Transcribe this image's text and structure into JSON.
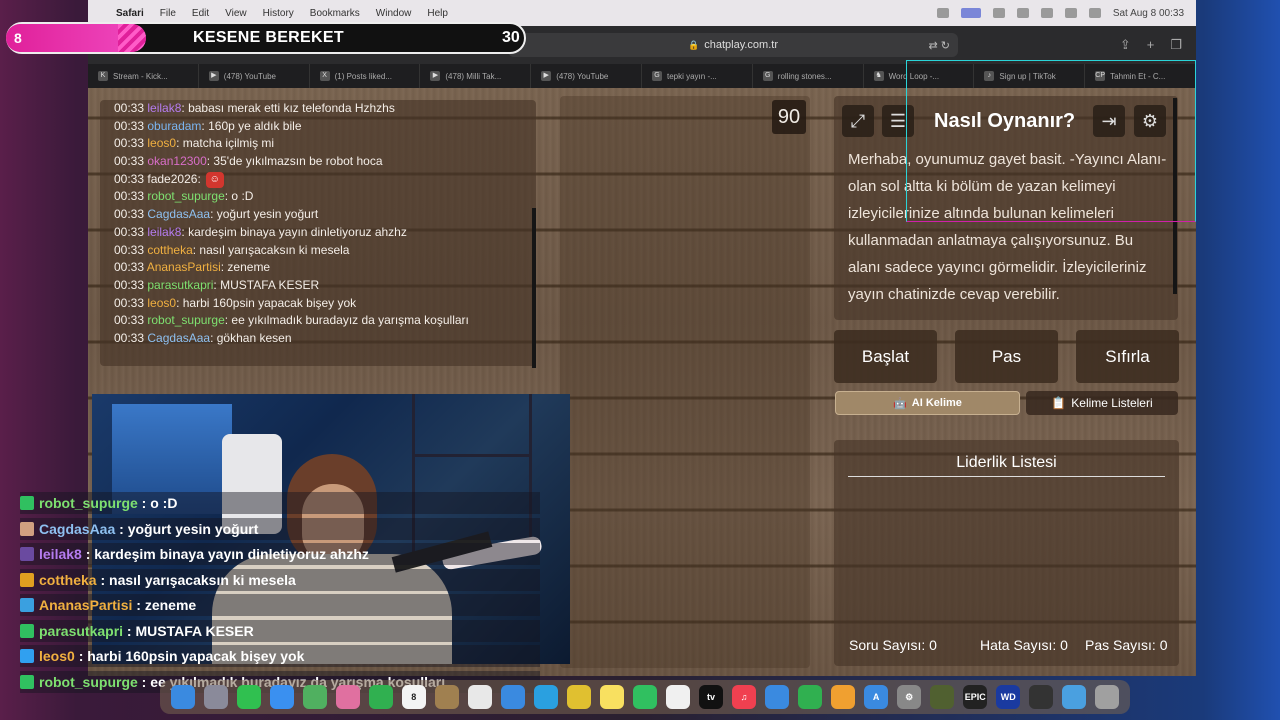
{
  "menubar": {
    "app": "Safari",
    "items": [
      "File",
      "Edit",
      "View",
      "History",
      "Bookmarks",
      "Window",
      "Help"
    ],
    "clock": "Sat Aug 8  00:33"
  },
  "browser": {
    "url": "chatplay.com.tr",
    "tabs": [
      {
        "label": "Stream - Kick...",
        "icon": "K"
      },
      {
        "label": "(478) YouTube",
        "icon": "▶"
      },
      {
        "label": "(1) Posts liked...",
        "icon": "X"
      },
      {
        "label": "(478) Milli Tak...",
        "icon": "▶"
      },
      {
        "label": "(478) YouTube",
        "icon": "▶"
      },
      {
        "label": "tepki yayın -...",
        "icon": "G"
      },
      {
        "label": "rolling stones...",
        "icon": "G"
      },
      {
        "label": "Word Loop -...",
        "icon": "♞"
      },
      {
        "label": "Sign up | TikTok",
        "icon": "♪"
      },
      {
        "label": "Tahmin Et - C...",
        "icon": "CP"
      }
    ]
  },
  "stream_overlay": {
    "score": "8",
    "title": "KESENE BEREKET",
    "count": "30"
  },
  "page_chat": [
    {
      "time": "00:33",
      "user": "leilak8",
      "color": "#b57cf0",
      "msg": ": babası merak etti kız telefonda Hzhzhs"
    },
    {
      "time": "00:33",
      "user": "oburadam",
      "color": "#7ab4f0",
      "msg": ": 160p ye aldık bile"
    },
    {
      "time": "00:33",
      "user": "leos0",
      "color": "#f0b040",
      "msg": ": matcha içilmiş mi"
    },
    {
      "time": "00:33",
      "user": "okan12300",
      "color": "#d86ec8",
      "msg": ": 35'de yıkılmazsın be robot hoca"
    },
    {
      "time": "00:33",
      "user": "fade2026",
      "color": "#f4eee8",
      "msg": ":",
      "badge": true
    },
    {
      "time": "00:33",
      "user": "robot_supurge",
      "color": "#7ee070",
      "msg": ": o :D"
    },
    {
      "time": "00:33",
      "user": "CagdasAaa",
      "color": "#8ec0f0",
      "msg": ": yoğurt yesin yoğurt"
    },
    {
      "time": "00:33",
      "user": "leilak8",
      "color": "#b57cf0",
      "msg": ": kardeşim binaya yayın dinletiyoruz ahzhz"
    },
    {
      "time": "00:33",
      "user": "cottheka",
      "color": "#f0b040",
      "msg": ": nasıl yarışacaksın ki mesela"
    },
    {
      "time": "00:33",
      "user": "AnanasPartisi",
      "color": "#f0b040",
      "msg": ": zeneme"
    },
    {
      "time": "00:33",
      "user": "parasutkapri",
      "color": "#7ee070",
      "msg": ": MUSTAFA KESER"
    },
    {
      "time": "00:33",
      "user": "leos0",
      "color": "#f0b040",
      "msg": ": harbi 160psin yapacak bişey yok"
    },
    {
      "time": "00:33",
      "user": "robot_supurge",
      "color": "#7ee070",
      "msg": ": ee yıkılmadık buradayız da yarışma koşulları"
    },
    {
      "time": "00:33",
      "user": "CagdasAaa",
      "color": "#8ec0f0",
      "msg": ": gökhan kesen"
    }
  ],
  "game": {
    "timer": "90",
    "howto_title": "Nasıl Oynanır?",
    "howto_text": "Merhaba, oyunumuz gayet basit. -Yayıncı Alanı- olan sol altta ki bölüm de yazan kelimeyi izleyicilerinize altında bulunan kelimeleri kullanmadan anlatmaya çalışıyorsunuz. Bu alanı sadece yayıncı görmelidir. İzleyicileriniz yayın chatinizde cevap verebilir.",
    "buttons": {
      "start": "Başlat",
      "pass": "Pas",
      "reset": "Sıfırla"
    },
    "ai_word": "AI Kelime",
    "word_lists": "Kelime Listeleri",
    "leaderboard_title": "Liderlik Listesi",
    "stats": {
      "questions": "Soru Sayısı: 0",
      "errors": "Hata Sayısı: 0",
      "passes": "Pas Sayısı: 0"
    }
  },
  "overlay_chat": [
    {
      "user": "robot_supurge",
      "color": "#7ee070",
      "badge": "#30c060",
      "msg": " : o :D"
    },
    {
      "user": "CagdasAaa",
      "color": "#8ec0f0",
      "badge": "#d0a080",
      "msg": " : yoğurt yesin yoğurt"
    },
    {
      "user": "leilak8",
      "color": "#b57cf0",
      "badge": "#6a4aa0",
      "msg": " : kardeşim binaya yayın dinletiyoruz ahzhz"
    },
    {
      "user": "cottheka",
      "color": "#f0b040",
      "badge": "#e0a020",
      "msg": " : nasıl yarışacaksın ki mesela"
    },
    {
      "user": "AnanasPartisi",
      "color": "#f0b040",
      "badge": "#3aa0e0",
      "msg": " : zeneme"
    },
    {
      "user": "parasutkapri",
      "color": "#7ee070",
      "badge": "#30c060",
      "msg": " : MUSTAFA KESER"
    },
    {
      "user": "leos0",
      "color": "#f0b040",
      "badge": "#30a0f0",
      "msg": " : harbi 160psin yapacak bişey yok"
    },
    {
      "user": "robot_supurge",
      "color": "#7ee070",
      "badge": "#30c060",
      "msg": " : ee yıkılmadık buradayız da yarışma koşulları"
    }
  ],
  "dock": [
    {
      "name": "finder-icon",
      "color": "#3a8ae0",
      "glyph": ""
    },
    {
      "name": "launchpad-icon",
      "color": "#8a8a9a",
      "glyph": ""
    },
    {
      "name": "messages-icon",
      "color": "#30c050",
      "glyph": ""
    },
    {
      "name": "mail-icon",
      "color": "#3a90f0",
      "glyph": ""
    },
    {
      "name": "maps-icon",
      "color": "#50b060",
      "glyph": ""
    },
    {
      "name": "photos-icon",
      "color": "#e070a0",
      "glyph": ""
    },
    {
      "name": "facetime-icon",
      "color": "#30b050",
      "glyph": ""
    },
    {
      "name": "calendar-icon",
      "color": "#f4f4f4",
      "glyph": "8"
    },
    {
      "name": "notes-folder-icon",
      "color": "#a08050",
      "glyph": ""
    },
    {
      "name": "reminders-icon",
      "color": "#e8e8e8",
      "glyph": ""
    },
    {
      "name": "safari-icon",
      "color": "#3a8ae0",
      "glyph": ""
    },
    {
      "name": "telegram-icon",
      "color": "#2aa0e0",
      "glyph": ""
    },
    {
      "name": "chrome-icon",
      "color": "#e0c030",
      "glyph": ""
    },
    {
      "name": "notes-icon",
      "color": "#f8e060",
      "glyph": ""
    },
    {
      "name": "whatsapp-icon",
      "color": "#30c060",
      "glyph": ""
    },
    {
      "name": "freeform-icon",
      "color": "#f0f0f0",
      "glyph": ""
    },
    {
      "name": "appletv-icon",
      "color": "#111111",
      "glyph": "tv"
    },
    {
      "name": "music-icon",
      "color": "#f04050",
      "glyph": "♫"
    },
    {
      "name": "keynote-icon",
      "color": "#3a8ae0",
      "glyph": ""
    },
    {
      "name": "numbers-icon",
      "color": "#30b050",
      "glyph": ""
    },
    {
      "name": "pages-icon",
      "color": "#f0a030",
      "glyph": ""
    },
    {
      "name": "appstore-icon",
      "color": "#3a8ae0",
      "glyph": "A"
    },
    {
      "name": "settings-icon",
      "color": "#888888",
      "glyph": "⚙"
    },
    {
      "name": "game-icon",
      "color": "#506030",
      "glyph": ""
    },
    {
      "name": "epic-games-icon",
      "color": "#222222",
      "glyph": "EPIC"
    },
    {
      "name": "wd-icon",
      "color": "#1a3aa0",
      "glyph": "WD"
    },
    {
      "name": "obs-icon",
      "color": "#333333",
      "glyph": ""
    },
    {
      "name": "downloads-folder-icon",
      "color": "#4aa0e0",
      "glyph": ""
    },
    {
      "name": "trash-icon",
      "color": "#a0a0a0",
      "glyph": ""
    }
  ]
}
